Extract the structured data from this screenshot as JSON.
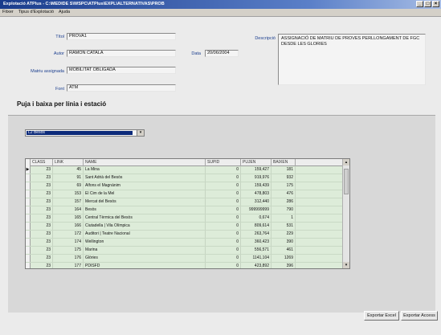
{
  "window": {
    "title": "Explotació ATPlus - C:\\MEDIDE S\\WSPC\\ATPlus\\EXPL\\ALTERNATIVAS\\PROB"
  },
  "menu": [
    "Fitxer",
    "Tipus d'Explotació",
    "Ajuda"
  ],
  "form": {
    "titol_label": "Títol",
    "titol_value": "PROVA1",
    "autor_label": "Autor",
    "autor_value": "RAMON CATALA",
    "data_label": "Data",
    "data_value": "20/06/2004",
    "matriu_label": "Matriu assignada",
    "matriu_value": "MOBILITAT OBLIGADA",
    "font_label": "Font",
    "font_value": "ATM",
    "descripcio_label": "Descripció",
    "descripcio_value": "ASSIGNACIÓ DE MATRIU DE PROVES PERLLONGAMENT DE FGC DESDE LES GLORIES"
  },
  "section_title": "Puja i baixa per línia i estació",
  "line_combo": {
    "selected": "L2 Besòs"
  },
  "table": {
    "columns": [
      "CLASS",
      "LINK",
      "NAME",
      "SUPID",
      "PUJEN",
      "BAIXEN"
    ],
    "rows": [
      [
        "23",
        "45",
        "La Mina",
        "0",
        "159,427",
        "181"
      ],
      [
        "23",
        "91",
        "Sant Adrià del Besòs",
        "0",
        "919,976",
        "932"
      ],
      [
        "23",
        "69",
        "Alfons el Magnànim",
        "0",
        "159,439",
        "175"
      ],
      [
        "23",
        "153",
        "El Cim de la Mel",
        "0",
        "478,803",
        "476"
      ],
      [
        "23",
        "157",
        "Mercat del Besòs",
        "0",
        "312,440",
        "286"
      ],
      [
        "23",
        "164",
        "Besòs",
        "0",
        "999999999",
        "790"
      ],
      [
        "23",
        "165",
        "Central Tèrmica del Besòs",
        "0",
        "0,674",
        "1"
      ],
      [
        "23",
        "166",
        "Ciutadella | Vila Olímpica",
        "0",
        "809,614",
        "531"
      ],
      [
        "23",
        "172",
        "Auditori | Teatre Nacional",
        "0",
        "263,764",
        "229"
      ],
      [
        "23",
        "174",
        "Wellington",
        "0",
        "360,423",
        "390"
      ],
      [
        "23",
        "175",
        "Marina",
        "0",
        "556,571",
        "461"
      ],
      [
        "23",
        "176",
        "Glòries",
        "0",
        "1141,104",
        "1269"
      ],
      [
        "23",
        "177",
        "PDISFD",
        "0",
        "423,892",
        "396"
      ]
    ]
  },
  "buttons": {
    "export_excel": "Exportar Excel",
    "export_access": "Exportar Access"
  }
}
